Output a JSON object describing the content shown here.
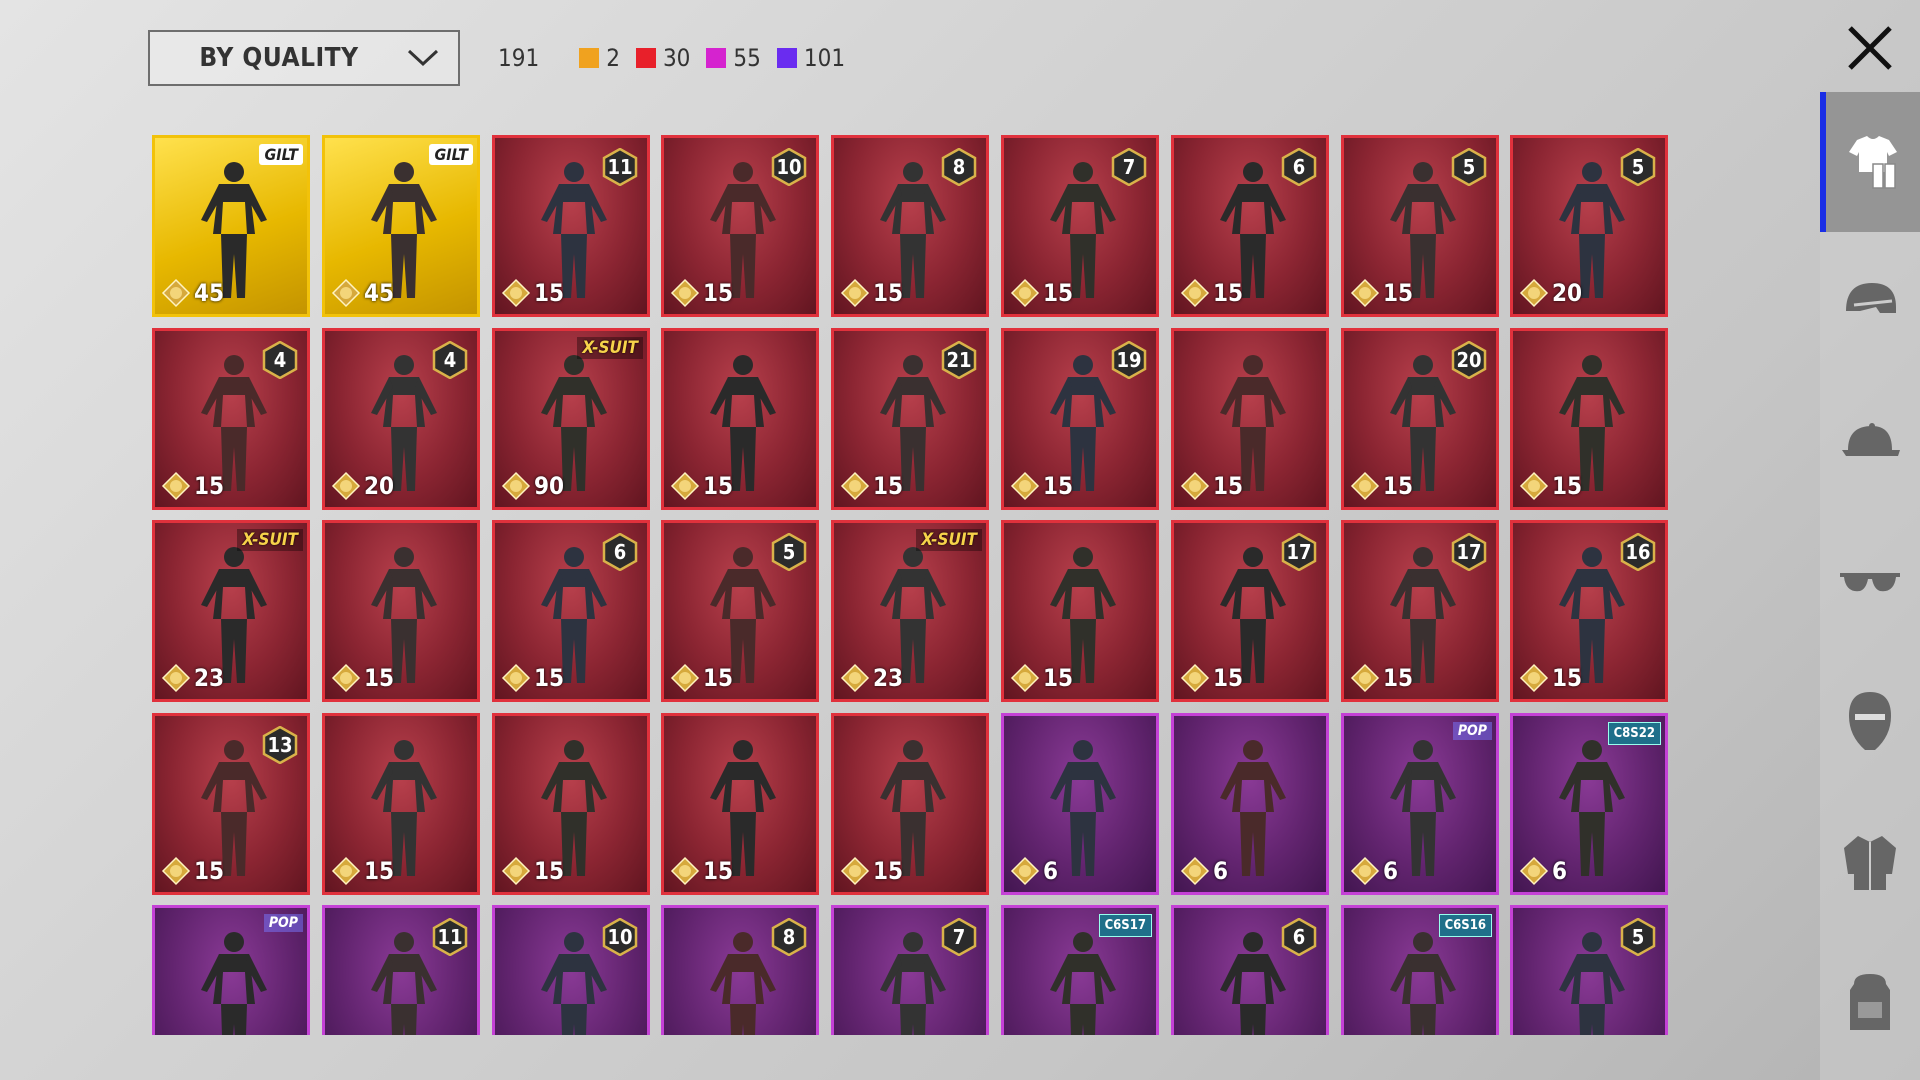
{
  "filter": {
    "label": "BY QUALITY"
  },
  "summary": {
    "total": "191",
    "groups": [
      {
        "count": "2",
        "color": "#f0a21f"
      },
      {
        "count": "30",
        "color": "#e8202a"
      },
      {
        "count": "55",
        "color": "#d523cf"
      },
      {
        "count": "101",
        "color": "#6a2cf0"
      }
    ]
  },
  "sidebar": {
    "tabs": [
      {
        "icon": "outfit-icon",
        "active": true
      },
      {
        "icon": "helmet-icon",
        "active": false
      },
      {
        "icon": "cap-icon",
        "active": false
      },
      {
        "icon": "sunglasses-icon",
        "active": false
      },
      {
        "icon": "mask-icon",
        "active": false
      },
      {
        "icon": "jacket-icon",
        "active": false
      },
      {
        "icon": "backpack-icon",
        "active": false
      }
    ]
  },
  "items": [
    {
      "rarity": "legendary",
      "price": "45",
      "tag": "GILT",
      "tagType": "gilt"
    },
    {
      "rarity": "legendary",
      "price": "45",
      "tag": "GILT",
      "tagType": "gilt"
    },
    {
      "rarity": "mythic",
      "price": "15",
      "badge": "11"
    },
    {
      "rarity": "mythic",
      "price": "15",
      "badge": "10"
    },
    {
      "rarity": "mythic",
      "price": "15",
      "badge": "8"
    },
    {
      "rarity": "mythic",
      "price": "15",
      "badge": "7"
    },
    {
      "rarity": "mythic",
      "price": "15",
      "badge": "6"
    },
    {
      "rarity": "mythic",
      "price": "15",
      "badge": "5"
    },
    {
      "rarity": "mythic",
      "price": "20",
      "badge": "5"
    },
    {
      "rarity": "mythic",
      "price": "15",
      "badge": "4"
    },
    {
      "rarity": "mythic",
      "price": "20",
      "badge": "4"
    },
    {
      "rarity": "mythic",
      "price": "90",
      "tag": "X-SUIT",
      "tagType": "xsuit"
    },
    {
      "rarity": "mythic",
      "price": "15"
    },
    {
      "rarity": "mythic",
      "price": "15",
      "badge": "21"
    },
    {
      "rarity": "mythic",
      "price": "15",
      "badge": "19"
    },
    {
      "rarity": "mythic",
      "price": "15"
    },
    {
      "rarity": "mythic",
      "price": "15",
      "badge": "20"
    },
    {
      "rarity": "mythic",
      "price": "15"
    },
    {
      "rarity": "mythic",
      "price": "23",
      "tag": "X-SUIT",
      "tagType": "xsuit"
    },
    {
      "rarity": "mythic",
      "price": "15"
    },
    {
      "rarity": "mythic",
      "price": "15",
      "badge": "6"
    },
    {
      "rarity": "mythic",
      "price": "15",
      "badge": "5"
    },
    {
      "rarity": "mythic",
      "price": "23",
      "tag": "X-SUIT",
      "tagType": "xsuit"
    },
    {
      "rarity": "mythic",
      "price": "15"
    },
    {
      "rarity": "mythic",
      "price": "15",
      "badge": "17"
    },
    {
      "rarity": "mythic",
      "price": "15",
      "badge": "17"
    },
    {
      "rarity": "mythic",
      "price": "15",
      "badge": "16"
    },
    {
      "rarity": "mythic",
      "price": "15",
      "badge": "13"
    },
    {
      "rarity": "mythic",
      "price": "15"
    },
    {
      "rarity": "mythic",
      "price": "15"
    },
    {
      "rarity": "mythic",
      "price": "15"
    },
    {
      "rarity": "mythic",
      "price": "15"
    },
    {
      "rarity": "epic",
      "price": "6"
    },
    {
      "rarity": "epic",
      "price": "6"
    },
    {
      "rarity": "epic",
      "price": "6",
      "tag": "POP",
      "tagType": "pop"
    },
    {
      "rarity": "epic",
      "price": "6",
      "tag": "C8S22",
      "tagType": "season"
    },
    {
      "rarity": "epic",
      "price": "",
      "tag": "POP",
      "tagType": "pop"
    },
    {
      "rarity": "epic",
      "price": "",
      "badge": "11"
    },
    {
      "rarity": "epic",
      "price": "",
      "badge": "10"
    },
    {
      "rarity": "epic",
      "price": "",
      "badge": "8"
    },
    {
      "rarity": "epic",
      "price": "",
      "badge": "7"
    },
    {
      "rarity": "epic",
      "price": "",
      "tag": "C6S17",
      "tagType": "season"
    },
    {
      "rarity": "epic",
      "price": "",
      "badge": "6"
    },
    {
      "rarity": "epic",
      "price": "",
      "tag": "C6S16",
      "tagType": "season"
    },
    {
      "rarity": "epic",
      "price": "",
      "badge": "5"
    }
  ]
}
